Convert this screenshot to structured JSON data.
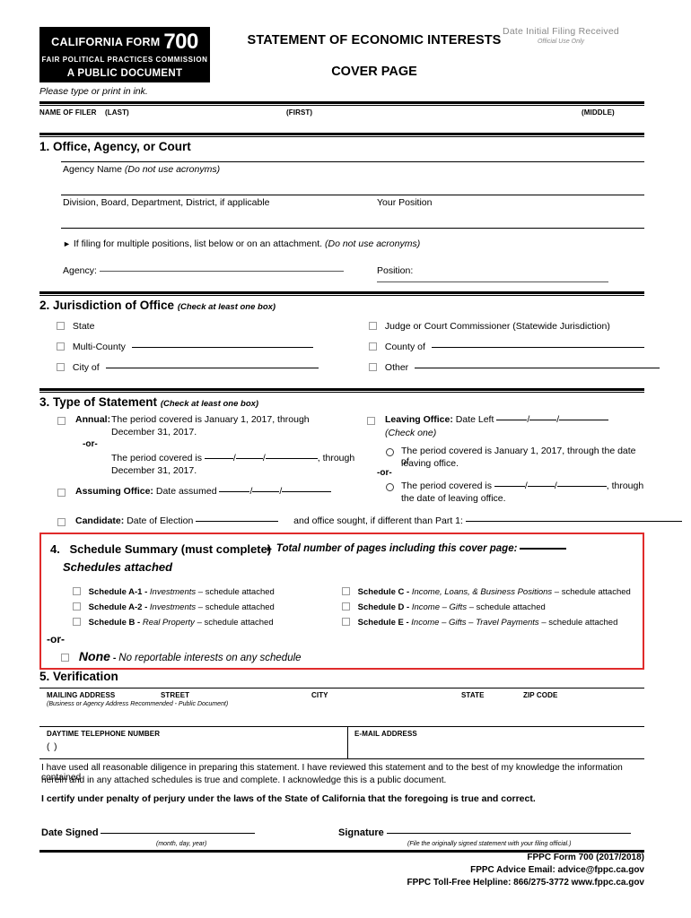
{
  "header": {
    "logo_line1_pre": "CALIFORNIA FORM",
    "logo_line1_num": "700",
    "logo_line2": "FAIR POLITICAL PRACTICES COMMISSION",
    "logo_line3": "A PUBLIC DOCUMENT",
    "title": "STATEMENT OF ECONOMIC INTERESTS",
    "subtitle": "COVER PAGE",
    "official_use_line1": "Date Initial Filing Received",
    "official_use_line2": "Official Use Only",
    "print_instruction": "Please type or print in ink."
  },
  "filer": {
    "name_label": "NAME OF FILER",
    "last_label": "(LAST)",
    "first_label": "(FIRST)",
    "middle_label": "(MIDDLE)"
  },
  "section1": {
    "heading": "1. Office, Agency, or Court",
    "agency_name_label": "Agency Name",
    "agency_name_note": "(Do not use acronyms)",
    "division_label": "Division, Board, Department, District, if applicable",
    "position_label": "Your Position",
    "multi_note_arrow": "►",
    "multi_note": "If filing for multiple positions, list below or on an attachment.",
    "multi_note_italic": "(Do not use acronyms)",
    "agency_field_label": "Agency:",
    "position_field_label": "Position:"
  },
  "section2": {
    "heading_num": "2.",
    "heading": "Jurisdiction of Office",
    "heading_note": "(Check at least one box)",
    "options": [
      {
        "label": "State",
        "has_line": false
      },
      {
        "label": "Multi-County",
        "has_line": true
      },
      {
        "label": "City of",
        "has_line": true
      },
      {
        "label": "Judge or Court Commissioner (Statewide Jurisdiction)",
        "has_line": false
      },
      {
        "label": "County of",
        "has_line": true
      },
      {
        "label": "Other",
        "has_line": true
      }
    ]
  },
  "section3": {
    "heading_num": "3.",
    "heading": "Type of Statement",
    "heading_note": "(Check at least one box)",
    "annual_label": "Annual:",
    "annual_text_1": "The period covered is January 1, 2017, through",
    "annual_text_2": "December 31, 2017.",
    "or_label": "-or-",
    "annual_alt_1": "The period covered is",
    "annual_alt_sep1": "/",
    "annual_alt_sep2": "/",
    "annual_alt_tail": ", through",
    "annual_alt_2": "December 31, 2017.",
    "assuming_label": "Assuming Office:",
    "assuming_text": "Date assumed",
    "assuming_sep1": "/",
    "assuming_sep2": "/",
    "candidate_label": "Candidate:",
    "candidate_text": "Date of Election",
    "candidate_tail": "and office sought, if different than Part 1:",
    "leaving_label": "Leaving Office:",
    "leaving_text": "Date Left",
    "leaving_sep1": "/",
    "leaving_sep2": "/",
    "check_one": "(Check one)",
    "leaving_opt1_1": "The period covered is January 1, 2017, through the date of",
    "leaving_opt1_2": "leaving office.",
    "leaving_or": "-or-",
    "leaving_opt2_1": "The period covered is",
    "leaving_opt2_sep1": "/",
    "leaving_opt2_sep2": "/",
    "leaving_opt2_tail": ", through",
    "leaving_opt2_2": "the date of leaving office."
  },
  "section4": {
    "heading_num": "4.",
    "heading": "Schedule Summary (must complete)",
    "arrow": "►",
    "total_pages_label": "Total number of pages including this cover page:",
    "schedules_attached": "Schedules attached",
    "or_label": "-or-",
    "left_schedules": [
      {
        "name": "Schedule A-1 -",
        "desc": "Investments",
        "tail": "– schedule attached"
      },
      {
        "name": "Schedule A-2 -",
        "desc": "Investments",
        "tail": "– schedule attached"
      },
      {
        "name": "Schedule B -",
        "desc": "Real Property",
        "tail": "– schedule attached"
      }
    ],
    "right_schedules": [
      {
        "name": "Schedule C -",
        "desc": "Income, Loans, & Business Positions",
        "tail": "– schedule attached"
      },
      {
        "name": "Schedule D -",
        "desc": "Income – Gifts",
        "tail": "– schedule attached"
      },
      {
        "name": "Schedule E -",
        "desc": "Income – Gifts – Travel Payments",
        "tail": "– schedule attached"
      }
    ],
    "none_label": "None",
    "none_dash": "-",
    "none_desc": "No reportable interests on any schedule",
    "border_color": "#E02B2B"
  },
  "section5": {
    "heading": "5. Verification",
    "mailing_address_label": "MAILING ADDRESS",
    "street_label": "STREET",
    "city_label": "CITY",
    "state_label": "STATE",
    "zip_label": "ZIP CODE",
    "address_note": "(Business or Agency Address Recommended - Public Document)",
    "phone_label": "DAYTIME TELEPHONE NUMBER",
    "phone_parens": "(            )",
    "email_label": "E-MAIL ADDRESS",
    "declaration_1": "I have used all reasonable diligence in preparing this statement.  I have reviewed this statement and to the best of my knowledge the information contained",
    "declaration_2": "herein and in any attached schedules is true and complete.  I acknowledge this is a public document.",
    "certification": "I certify under penalty of perjury under the laws of the State of California that the foregoing is true and correct.",
    "date_signed_label": "Date Signed",
    "date_signed_note": "(month, day, year)",
    "signature_label": "Signature",
    "signature_note": "(File the originally signed statement with your filing official.)"
  },
  "footer": {
    "line1": "FPPC Form 700 (2017/2018)",
    "line2": "FPPC Advice Email: advice@fppc.ca.gov",
    "line3": "FPPC Toll-Free Helpline: 866/275-3772 www.fppc.ca.gov"
  }
}
